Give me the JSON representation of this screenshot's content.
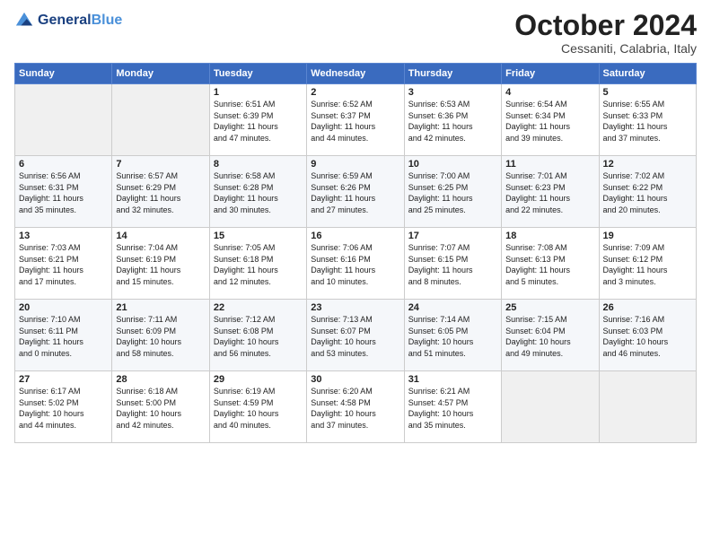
{
  "logo": {
    "line1": "General",
    "line2": "Blue"
  },
  "title": "October 2024",
  "subtitle": "Cessaniti, Calabria, Italy",
  "headers": [
    "Sunday",
    "Monday",
    "Tuesday",
    "Wednesday",
    "Thursday",
    "Friday",
    "Saturday"
  ],
  "weeks": [
    [
      {
        "num": "",
        "info": ""
      },
      {
        "num": "",
        "info": ""
      },
      {
        "num": "1",
        "info": "Sunrise: 6:51 AM\nSunset: 6:39 PM\nDaylight: 11 hours\nand 47 minutes."
      },
      {
        "num": "2",
        "info": "Sunrise: 6:52 AM\nSunset: 6:37 PM\nDaylight: 11 hours\nand 44 minutes."
      },
      {
        "num": "3",
        "info": "Sunrise: 6:53 AM\nSunset: 6:36 PM\nDaylight: 11 hours\nand 42 minutes."
      },
      {
        "num": "4",
        "info": "Sunrise: 6:54 AM\nSunset: 6:34 PM\nDaylight: 11 hours\nand 39 minutes."
      },
      {
        "num": "5",
        "info": "Sunrise: 6:55 AM\nSunset: 6:33 PM\nDaylight: 11 hours\nand 37 minutes."
      }
    ],
    [
      {
        "num": "6",
        "info": "Sunrise: 6:56 AM\nSunset: 6:31 PM\nDaylight: 11 hours\nand 35 minutes."
      },
      {
        "num": "7",
        "info": "Sunrise: 6:57 AM\nSunset: 6:29 PM\nDaylight: 11 hours\nand 32 minutes."
      },
      {
        "num": "8",
        "info": "Sunrise: 6:58 AM\nSunset: 6:28 PM\nDaylight: 11 hours\nand 30 minutes."
      },
      {
        "num": "9",
        "info": "Sunrise: 6:59 AM\nSunset: 6:26 PM\nDaylight: 11 hours\nand 27 minutes."
      },
      {
        "num": "10",
        "info": "Sunrise: 7:00 AM\nSunset: 6:25 PM\nDaylight: 11 hours\nand 25 minutes."
      },
      {
        "num": "11",
        "info": "Sunrise: 7:01 AM\nSunset: 6:23 PM\nDaylight: 11 hours\nand 22 minutes."
      },
      {
        "num": "12",
        "info": "Sunrise: 7:02 AM\nSunset: 6:22 PM\nDaylight: 11 hours\nand 20 minutes."
      }
    ],
    [
      {
        "num": "13",
        "info": "Sunrise: 7:03 AM\nSunset: 6:21 PM\nDaylight: 11 hours\nand 17 minutes."
      },
      {
        "num": "14",
        "info": "Sunrise: 7:04 AM\nSunset: 6:19 PM\nDaylight: 11 hours\nand 15 minutes."
      },
      {
        "num": "15",
        "info": "Sunrise: 7:05 AM\nSunset: 6:18 PM\nDaylight: 11 hours\nand 12 minutes."
      },
      {
        "num": "16",
        "info": "Sunrise: 7:06 AM\nSunset: 6:16 PM\nDaylight: 11 hours\nand 10 minutes."
      },
      {
        "num": "17",
        "info": "Sunrise: 7:07 AM\nSunset: 6:15 PM\nDaylight: 11 hours\nand 8 minutes."
      },
      {
        "num": "18",
        "info": "Sunrise: 7:08 AM\nSunset: 6:13 PM\nDaylight: 11 hours\nand 5 minutes."
      },
      {
        "num": "19",
        "info": "Sunrise: 7:09 AM\nSunset: 6:12 PM\nDaylight: 11 hours\nand 3 minutes."
      }
    ],
    [
      {
        "num": "20",
        "info": "Sunrise: 7:10 AM\nSunset: 6:11 PM\nDaylight: 11 hours\nand 0 minutes."
      },
      {
        "num": "21",
        "info": "Sunrise: 7:11 AM\nSunset: 6:09 PM\nDaylight: 10 hours\nand 58 minutes."
      },
      {
        "num": "22",
        "info": "Sunrise: 7:12 AM\nSunset: 6:08 PM\nDaylight: 10 hours\nand 56 minutes."
      },
      {
        "num": "23",
        "info": "Sunrise: 7:13 AM\nSunset: 6:07 PM\nDaylight: 10 hours\nand 53 minutes."
      },
      {
        "num": "24",
        "info": "Sunrise: 7:14 AM\nSunset: 6:05 PM\nDaylight: 10 hours\nand 51 minutes."
      },
      {
        "num": "25",
        "info": "Sunrise: 7:15 AM\nSunset: 6:04 PM\nDaylight: 10 hours\nand 49 minutes."
      },
      {
        "num": "26",
        "info": "Sunrise: 7:16 AM\nSunset: 6:03 PM\nDaylight: 10 hours\nand 46 minutes."
      }
    ],
    [
      {
        "num": "27",
        "info": "Sunrise: 6:17 AM\nSunset: 5:02 PM\nDaylight: 10 hours\nand 44 minutes."
      },
      {
        "num": "28",
        "info": "Sunrise: 6:18 AM\nSunset: 5:00 PM\nDaylight: 10 hours\nand 42 minutes."
      },
      {
        "num": "29",
        "info": "Sunrise: 6:19 AM\nSunset: 4:59 PM\nDaylight: 10 hours\nand 40 minutes."
      },
      {
        "num": "30",
        "info": "Sunrise: 6:20 AM\nSunset: 4:58 PM\nDaylight: 10 hours\nand 37 minutes."
      },
      {
        "num": "31",
        "info": "Sunrise: 6:21 AM\nSunset: 4:57 PM\nDaylight: 10 hours\nand 35 minutes."
      },
      {
        "num": "",
        "info": ""
      },
      {
        "num": "",
        "info": ""
      }
    ]
  ]
}
